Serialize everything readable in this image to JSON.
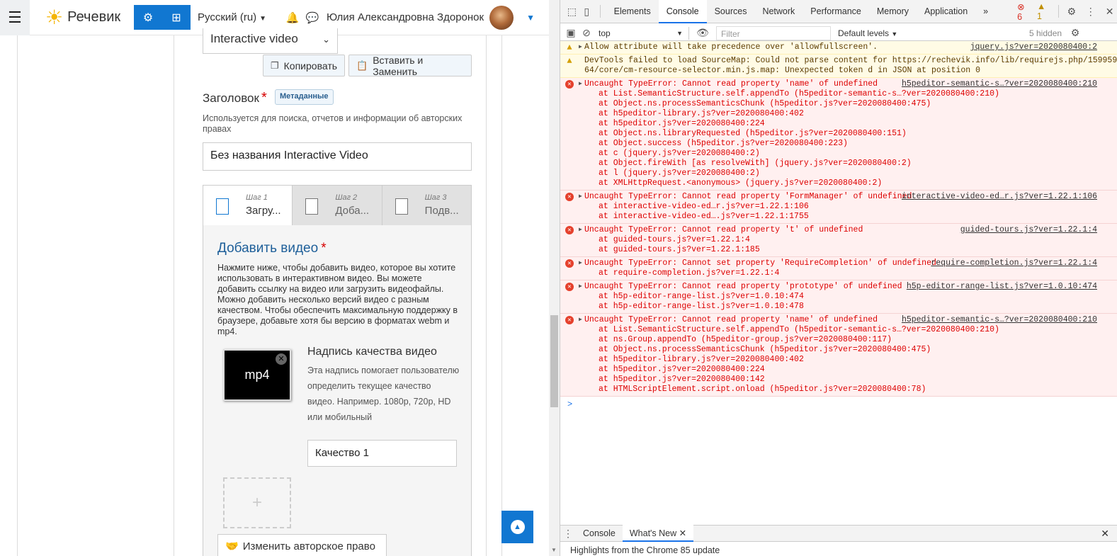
{
  "navbar": {
    "brand": "Речевик",
    "language": "Русский (ru)",
    "user_name": "Юлия Александровна Здоронок"
  },
  "editor": {
    "select_value": "Interactive video",
    "copy_label": "Копировать",
    "paste_label": "Вставить и Заменить",
    "title_label": "Заголовок",
    "metadata_badge": "Метаданные",
    "title_desc": "Используется для поиска, отчетов и информации об авторских правах",
    "title_value": "Без названия Interactive Video",
    "steps": [
      {
        "num": "Шаг 1",
        "title": "Загру..."
      },
      {
        "num": "Шаг 2",
        "title": "Доба..."
      },
      {
        "num": "Шаг 3",
        "title": "Подв..."
      }
    ],
    "add_video_title": "Добавить видео",
    "add_video_desc": "Нажмите ниже, чтобы добавить видео, которое вы хотите использовать в интерактивном видео. Вы можете добавить ссылку на видео или загрузить видеофайлы. Можно добавить несколько версий видео с разным качеством. Чтобы обеспечить максимальную поддержку в браузере, добавьте хотя бы версию в форматах webm и mp4.",
    "video_format": "mp4",
    "quality_label": "Надпись качества видео",
    "quality_desc": "Эта надпись помогает пользователю определить текущее качество видео. Например. 1080p, 720p, HD или мобильный",
    "quality_value": "Качество 1",
    "add_plus": "+",
    "copyright_btn": "Изменить авторское право"
  },
  "devtools": {
    "tabs": [
      "Elements",
      "Console",
      "Sources",
      "Network",
      "Performance",
      "Memory",
      "Application"
    ],
    "more": "»",
    "errors": "6",
    "warnings": "1",
    "context": "top",
    "filter_placeholder": "Filter",
    "levels": "Default levels",
    "hidden": "5 hidden",
    "prompt": ">",
    "drawer_tabs": [
      "Console",
      "What's New"
    ],
    "whats_new": "Highlights from the Chrome 85 update",
    "messages": [
      {
        "type": "warn",
        "lines": [
          "Allow attribute will take precedence over 'allowfullscreen'."
        ],
        "src": "jquery.js?ver=2020080400:2",
        "stack": []
      },
      {
        "type": "warn",
        "lines": [
          "DevTools failed to load SourceMap: Could not parse content for https://rechevik.info/lib/requirejs.php/15995954",
          "64/core/cm-resource-selector.min.js.map: Unexpected token d in JSON at position 0"
        ],
        "src": "",
        "stack": []
      },
      {
        "type": "err",
        "lines": [
          "Uncaught TypeError: Cannot read property 'name' of undefined"
        ],
        "src": "h5peditor-semantic-s…?ver=2020080400:210",
        "stack": [
          "at List.SemanticStructure.self.appendTo (h5peditor-semantic-s…?ver=2020080400:210)",
          "at Object.ns.processSemanticsChunk (h5peditor.js?ver=2020080400:475)",
          "at h5peditor-library.js?ver=2020080400:402",
          "at h5peditor.js?ver=2020080400:224",
          "at Object.ns.libraryRequested (h5peditor.js?ver=2020080400:151)",
          "at Object.success (h5peditor.js?ver=2020080400:223)",
          "at c (jquery.js?ver=2020080400:2)",
          "at Object.fireWith [as resolveWith] (jquery.js?ver=2020080400:2)",
          "at l (jquery.js?ver=2020080400:2)",
          "at XMLHttpRequest.<anonymous> (jquery.js?ver=2020080400:2)"
        ]
      },
      {
        "type": "err",
        "lines": [
          "Uncaught TypeError: Cannot read property 'FormManager' of undefined"
        ],
        "src": "interactive-video-ed…r.js?ver=1.22.1:106",
        "stack": [
          "at interactive-video-ed…r.js?ver=1.22.1:106",
          "at interactive-video-ed….js?ver=1.22.1:1755"
        ]
      },
      {
        "type": "err",
        "lines": [
          "Uncaught TypeError: Cannot read property 't' of undefined"
        ],
        "src": "guided-tours.js?ver=1.22.1:4",
        "stack": [
          "at guided-tours.js?ver=1.22.1:4",
          "at guided-tours.js?ver=1.22.1:185"
        ]
      },
      {
        "type": "err",
        "lines": [
          "Uncaught TypeError: Cannot set property 'RequireCompletion' of undefined"
        ],
        "src": "require-completion.js?ver=1.22.1:4",
        "stack": [
          "at require-completion.js?ver=1.22.1:4"
        ]
      },
      {
        "type": "err",
        "lines": [
          "Uncaught TypeError: Cannot read property 'prototype' of undefined"
        ],
        "src": "h5p-editor-range-list.js?ver=1.0.10:474",
        "stack": [
          "at h5p-editor-range-list.js?ver=1.0.10:474",
          "at h5p-editor-range-list.js?ver=1.0.10:478"
        ]
      },
      {
        "type": "err",
        "lines": [
          "Uncaught TypeError: Cannot read property 'name' of undefined"
        ],
        "src": "h5peditor-semantic-s…?ver=2020080400:210",
        "stack": [
          "at List.SemanticStructure.self.appendTo (h5peditor-semantic-s…?ver=2020080400:210)",
          "at ns.Group.appendTo (h5peditor-group.js?ver=2020080400:117)",
          "at Object.ns.processSemanticsChunk (h5peditor.js?ver=2020080400:475)",
          "at h5peditor-library.js?ver=2020080400:402",
          "at h5peditor.js?ver=2020080400:224",
          "at h5peditor.js?ver=2020080400:142",
          "at HTMLScriptElement.script.onload (h5peditor.js?ver=2020080400:78)"
        ]
      }
    ]
  }
}
